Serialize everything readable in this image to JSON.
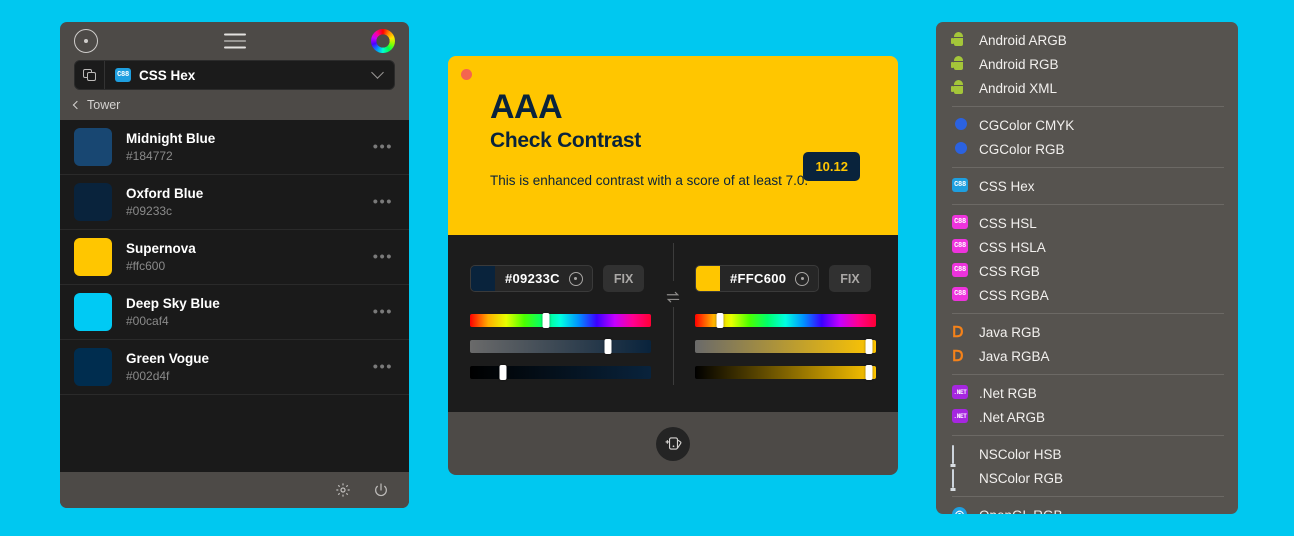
{
  "app": {
    "accent_background": "#00c8f0",
    "panel_surface": "#4d4a47",
    "list_surface": "#1a1a1a"
  },
  "left_panel": {
    "titlebar": {
      "picker_icon": "target-icon",
      "menu_icon": "hamburger-icon",
      "wheel_icon": "color-wheel-icon"
    },
    "format_selector": {
      "copy_icon": "copy-icon",
      "format_badge_text": "C88",
      "format_badge_color": "#1e9fe0",
      "label": "CSS Hex",
      "chevron_icon": "chevron-down-icon"
    },
    "breadcrumb": {
      "back_icon": "chevron-left-icon",
      "label": "Tower"
    },
    "colors": [
      {
        "name": "Midnight Blue",
        "hex": "#184772",
        "swatch": "#184772",
        "menu": "•••"
      },
      {
        "name": "Oxford Blue",
        "hex": "#09233c",
        "swatch": "#09233c",
        "menu": "•••"
      },
      {
        "name": "Supernova",
        "hex": "#ffc600",
        "swatch": "#ffc600",
        "menu": "•••"
      },
      {
        "name": "Deep Sky Blue",
        "hex": "#00caf4",
        "swatch": "#00caf4",
        "menu": "•••"
      },
      {
        "name": "Green Vogue",
        "hex": "#002d4f",
        "swatch": "#002d4f",
        "menu": "•••"
      }
    ],
    "footer": {
      "settings_icon": "gear-icon",
      "power_icon": "power-icon"
    }
  },
  "center_panel": {
    "close_button": "close-dot",
    "hero_background": "#ffc600",
    "hero_text_color": "#09233c",
    "rating": "AAA",
    "title": "Check Contrast",
    "description": "This is enhanced contrast with a score of at least 7.0.",
    "score": "10.12",
    "score_badge_bg": "#09233c",
    "score_badge_fg": "#ffc600",
    "foreground_editor": {
      "swatch": "#09233C",
      "hex": "#09233C",
      "picker_icon": "eyedropper-icon",
      "fix_label": "FIX",
      "sliders": [
        {
          "name": "hue",
          "position": 42
        },
        {
          "name": "saturation",
          "position": 76
        },
        {
          "name": "brightness",
          "position": 18
        }
      ]
    },
    "background_editor": {
      "swatch": "#FFC600",
      "hex": "#FFC600",
      "picker_icon": "eyedropper-icon",
      "fix_label": "FIX",
      "sliders": [
        {
          "name": "hue",
          "position": 14
        },
        {
          "name": "saturation",
          "position": 96
        },
        {
          "name": "brightness",
          "position": 96
        }
      ]
    },
    "swap_icon": "swap-arrows-icon",
    "footer": {
      "add_palette_icon": "add-palette-icon"
    }
  },
  "right_panel": {
    "groups": [
      {
        "items": [
          {
            "label": "Android ARGB",
            "icon": "android-icon"
          },
          {
            "label": "Android RGB",
            "icon": "android-icon"
          },
          {
            "label": "Android XML",
            "icon": "android-icon"
          }
        ]
      },
      {
        "items": [
          {
            "label": "CGColor CMYK",
            "icon": "cgcolor-icon"
          },
          {
            "label": "CGColor RGB",
            "icon": "cgcolor-icon"
          }
        ]
      },
      {
        "items": [
          {
            "label": "CSS Hex",
            "icon": "css-icon",
            "badge": "C88",
            "badge_color": "#1e9fe0"
          }
        ]
      },
      {
        "items": [
          {
            "label": "CSS HSL",
            "icon": "css-icon",
            "badge": "C88",
            "badge_color": "#ee33dd"
          },
          {
            "label": "CSS HSLA",
            "icon": "css-icon",
            "badge": "C88",
            "badge_color": "#ee33dd"
          },
          {
            "label": "CSS RGB",
            "icon": "css-icon",
            "badge": "C88",
            "badge_color": "#ee33dd"
          },
          {
            "label": "CSS RGBA",
            "icon": "css-icon",
            "badge": "C88",
            "badge_color": "#ee33dd"
          }
        ]
      },
      {
        "items": [
          {
            "label": "Java RGB",
            "icon": "java-icon"
          },
          {
            "label": "Java RGBA",
            "icon": "java-icon"
          }
        ]
      },
      {
        "items": [
          {
            "label": ".Net RGB",
            "icon": "dotnet-icon",
            "badge": ".NET",
            "badge_color": "#a626e0"
          },
          {
            "label": ".Net ARGB",
            "icon": "dotnet-icon",
            "badge": ".NET",
            "badge_color": "#a626e0"
          }
        ]
      },
      {
        "items": [
          {
            "label": "NSColor HSB",
            "icon": "nscolor-icon"
          },
          {
            "label": "NSColor RGB",
            "icon": "nscolor-icon"
          }
        ]
      },
      {
        "items": [
          {
            "label": "OpenGL RGB",
            "icon": "opengl-icon"
          }
        ]
      }
    ]
  }
}
